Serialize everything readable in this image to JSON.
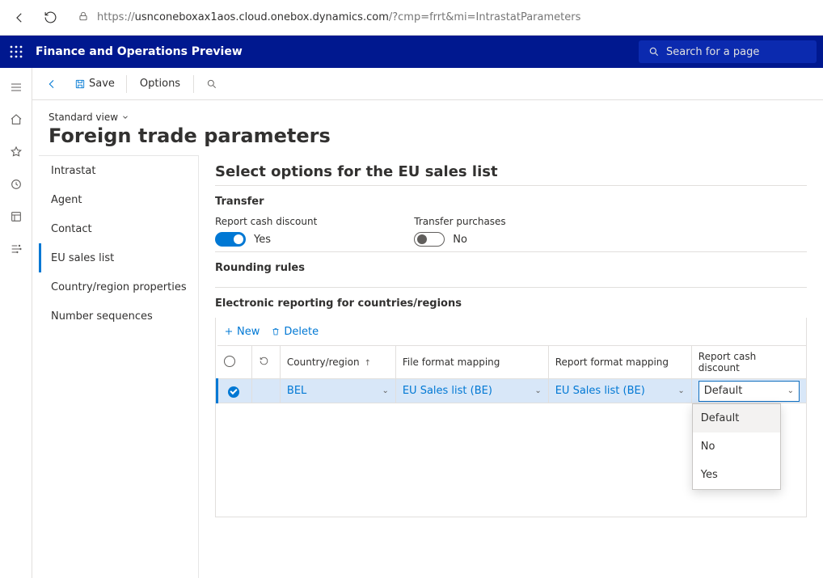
{
  "browser": {
    "url_prefix": "https://",
    "url_host": "usnconeboxax1aos.cloud.onebox.dynamics.com",
    "url_path": "/?cmp=frrt&mi=IntrastatParameters"
  },
  "app": {
    "title": "Finance and Operations Preview",
    "search_placeholder": "Search for a page"
  },
  "action_bar": {
    "save": "Save",
    "options": "Options"
  },
  "page": {
    "standard_view": "Standard view",
    "title": "Foreign trade parameters"
  },
  "sidemenu": {
    "items": [
      "Intrastat",
      "Agent",
      "Contact",
      "EU sales list",
      "Country/region properties",
      "Number sequences"
    ],
    "selected_index": 3
  },
  "pane": {
    "heading": "Select options for the EU sales list",
    "transfer_section": {
      "title": "Transfer",
      "report_cash_discount_label": "Report cash discount",
      "report_cash_discount_value": "Yes",
      "transfer_purchases_label": "Transfer purchases",
      "transfer_purchases_value": "No"
    },
    "rounding_section": {
      "title": "Rounding rules"
    },
    "er_section": {
      "title": "Electronic reporting for countries/regions",
      "new_btn": "New",
      "delete_btn": "Delete",
      "columns": {
        "country": "Country/region",
        "file_format": "File format mapping",
        "report_format": "Report format mapping",
        "report_cd": "Report cash discount"
      },
      "rows": [
        {
          "country": "BEL",
          "file_format": "EU Sales list (BE)",
          "report_format": "EU Sales list (BE)",
          "report_cd": "Default"
        }
      ],
      "dropdown_open": {
        "value": "Default",
        "options": [
          "Default",
          "No",
          "Yes"
        ]
      }
    }
  }
}
